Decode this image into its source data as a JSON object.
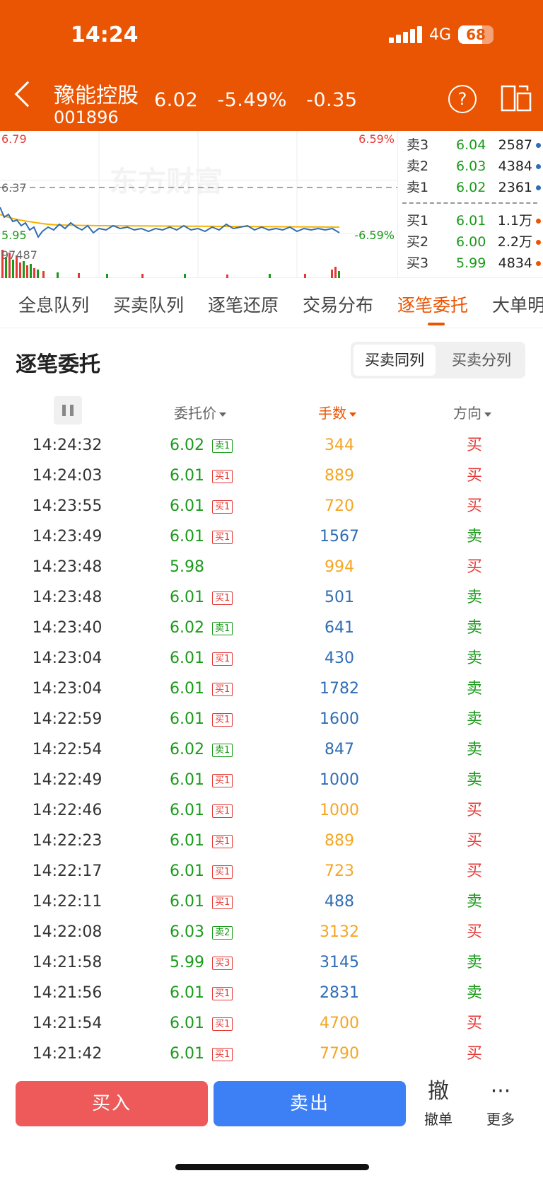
{
  "status": {
    "time": "14:24",
    "network": "4G",
    "battery": "68",
    "battery_level": 0.68
  },
  "stock": {
    "name": "豫能控股",
    "code": "001896",
    "price": "6.02",
    "change_pct": "-5.49%",
    "change": "-0.35"
  },
  "chart": {
    "high_price": "6.79",
    "high_pct": "6.59%",
    "ref_price": "6.37",
    "low_price": "5.95",
    "low_pct": "-6.59%",
    "volume_label": "97487",
    "watermark": "东方财富"
  },
  "orderbook": {
    "sells": [
      {
        "label": "卖3",
        "price": "6.04",
        "volume": "2587"
      },
      {
        "label": "卖2",
        "price": "6.03",
        "volume": "4384"
      },
      {
        "label": "卖1",
        "price": "6.02",
        "volume": "2361"
      }
    ],
    "buys": [
      {
        "label": "买1",
        "price": "6.01",
        "volume": "1.1万"
      },
      {
        "label": "买2",
        "price": "6.00",
        "volume": "2.2万"
      },
      {
        "label": "买3",
        "price": "5.99",
        "volume": "4834"
      }
    ]
  },
  "tabs": [
    "全息队列",
    "买卖队列",
    "逐笔还原",
    "交易分布",
    "逐笔委托",
    "大单明"
  ],
  "active_tab": "逐笔委托",
  "section": {
    "title": "逐笔委托",
    "toggle": [
      "买卖同列",
      "买卖分列"
    ]
  },
  "columns": {
    "price": "委托价",
    "volume": "手数",
    "direction": "方向"
  },
  "colors": {
    "brand": "#ea5504",
    "price_green": "#1a9a1a",
    "buy_red": "#e53935",
    "sell_green": "#1a9a1a",
    "vol_orange": "#f5a623",
    "vol_blue": "#2f6db5"
  },
  "rows": [
    {
      "time": "14:24:32",
      "price": "6.02",
      "tag": "卖1",
      "volume": "344",
      "direction": "买"
    },
    {
      "time": "14:24:03",
      "price": "6.01",
      "tag": "买1",
      "volume": "889",
      "direction": "买"
    },
    {
      "time": "14:23:55",
      "price": "6.01",
      "tag": "买1",
      "volume": "720",
      "direction": "买"
    },
    {
      "time": "14:23:49",
      "price": "6.01",
      "tag": "买1",
      "volume": "1567",
      "direction": "卖"
    },
    {
      "time": "14:23:48",
      "price": "5.98",
      "tag": "",
      "volume": "994",
      "direction": "买"
    },
    {
      "time": "14:23:48",
      "price": "6.01",
      "tag": "买1",
      "volume": "501",
      "direction": "卖"
    },
    {
      "time": "14:23:40",
      "price": "6.02",
      "tag": "卖1",
      "volume": "641",
      "direction": "卖"
    },
    {
      "time": "14:23:04",
      "price": "6.01",
      "tag": "买1",
      "volume": "430",
      "direction": "卖"
    },
    {
      "time": "14:23:04",
      "price": "6.01",
      "tag": "买1",
      "volume": "1782",
      "direction": "卖"
    },
    {
      "time": "14:22:59",
      "price": "6.01",
      "tag": "买1",
      "volume": "1600",
      "direction": "卖"
    },
    {
      "time": "14:22:54",
      "price": "6.02",
      "tag": "卖1",
      "volume": "847",
      "direction": "卖"
    },
    {
      "time": "14:22:49",
      "price": "6.01",
      "tag": "买1",
      "volume": "1000",
      "direction": "卖"
    },
    {
      "time": "14:22:46",
      "price": "6.01",
      "tag": "买1",
      "volume": "1000",
      "direction": "买"
    },
    {
      "time": "14:22:23",
      "price": "6.01",
      "tag": "买1",
      "volume": "889",
      "direction": "买"
    },
    {
      "time": "14:22:17",
      "price": "6.01",
      "tag": "买1",
      "volume": "723",
      "direction": "买"
    },
    {
      "time": "14:22:11",
      "price": "6.01",
      "tag": "买1",
      "volume": "488",
      "direction": "卖"
    },
    {
      "time": "14:22:08",
      "price": "6.03",
      "tag": "卖2",
      "volume": "3132",
      "direction": "买"
    },
    {
      "time": "14:21:58",
      "price": "5.99",
      "tag": "买3",
      "volume": "3145",
      "direction": "卖"
    },
    {
      "time": "14:21:56",
      "price": "6.01",
      "tag": "买1",
      "volume": "2831",
      "direction": "卖"
    },
    {
      "time": "14:21:54",
      "price": "6.01",
      "tag": "买1",
      "volume": "4700",
      "direction": "买"
    },
    {
      "time": "14:21:42",
      "price": "6.01",
      "tag": "买1",
      "volume": "7790",
      "direction": "买"
    }
  ],
  "bottom": {
    "buy": "买入",
    "sell": "卖出",
    "cancel_icon": "撤",
    "cancel": "撤单",
    "more_icon": "···",
    "more": "更多"
  }
}
